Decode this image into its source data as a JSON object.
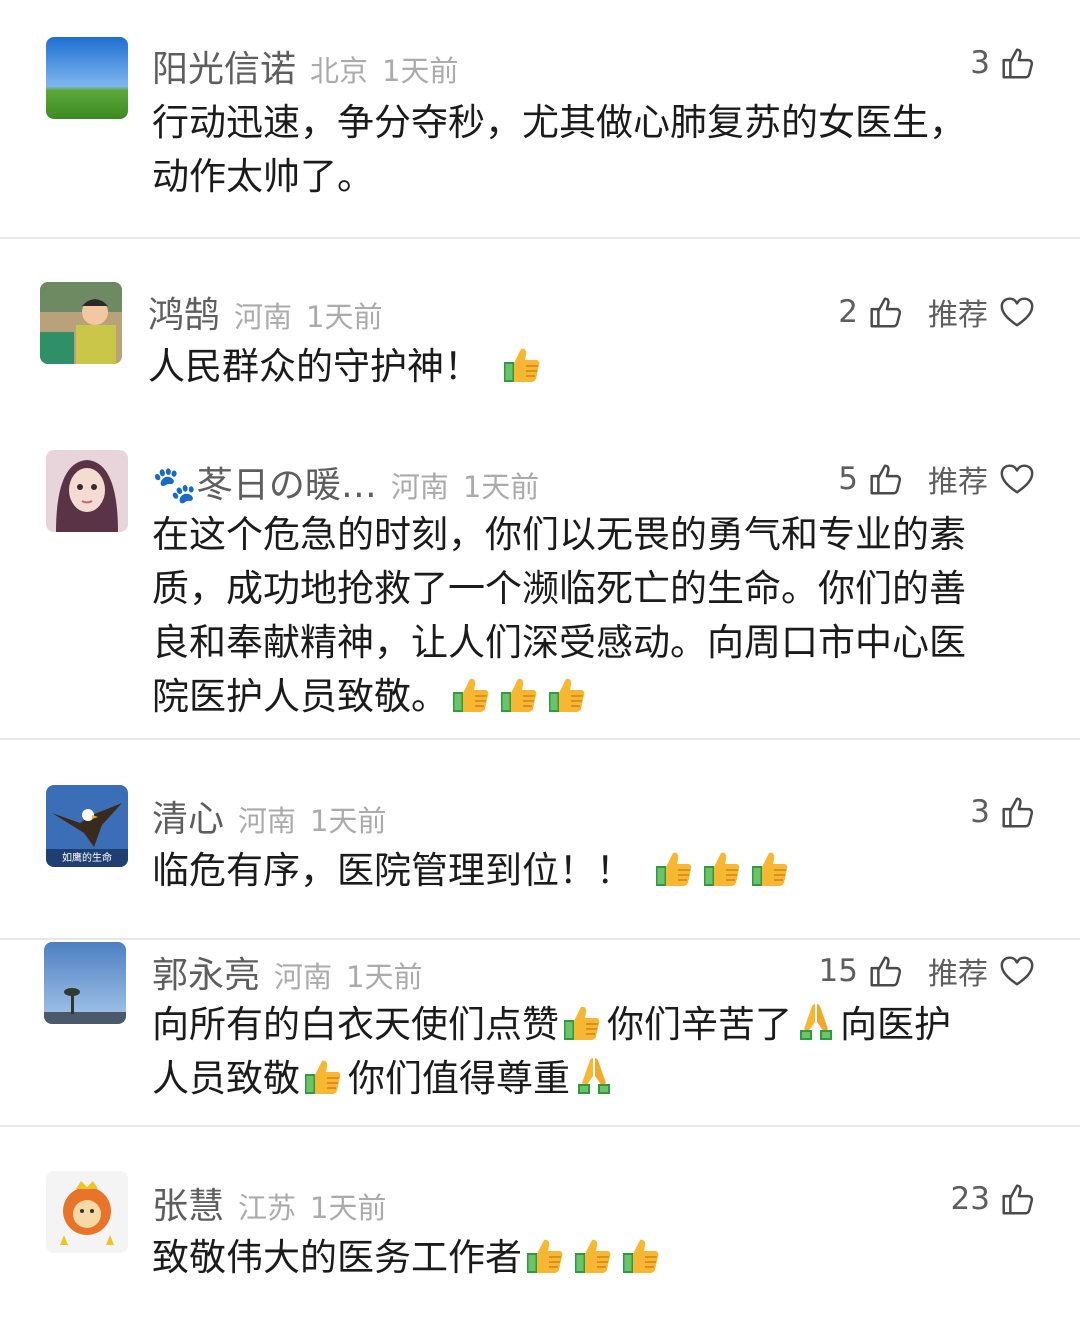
{
  "comments": [
    {
      "username": "阳光信诺",
      "location": "北京",
      "time": "1天前",
      "likes": "3",
      "recommend_label": "",
      "text": [
        "行动迅速，争分夺秒，尤其做心肺复苏的女医生，",
        "动作太帅了。"
      ]
    },
    {
      "username": "鸿鹄",
      "location": "河南",
      "time": "1天前",
      "likes": "2",
      "recommend_label": "推荐",
      "text_parts": [
        "人民群众的守护神！"
      ]
    },
    {
      "username": "🐾苳日の暖…",
      "location": "河南",
      "time": "1天前",
      "likes": "5",
      "recommend_label": "推荐",
      "text": [
        "在这个危急的时刻，你们以无畏的勇气和专业的素",
        "质，成功地抢救了一个濒临死亡的生命。你们的善",
        "良和奉献精神，让人们深受感动。向周口市中心医",
        "院医护人员致敬。"
      ]
    },
    {
      "username": "清心",
      "location": "河南",
      "time": "1天前",
      "likes": "3",
      "recommend_label": "",
      "text_parts": [
        "临危有序，医院管理到位！！"
      ],
      "avatar_caption": "如鹰的生命"
    },
    {
      "username": "郭永亮",
      "location": "河南",
      "time": "1天前",
      "likes": "15",
      "recommend_label": "推荐",
      "text_parts": [
        "向所有的白衣天使们点赞",
        "你们辛苦了",
        "向医护",
        "人员致敬",
        "你们值得尊重"
      ]
    },
    {
      "username": "张慧",
      "location": "江苏",
      "time": "1天前",
      "likes": "23",
      "recommend_label": "",
      "text_parts": [
        "致敬伟大的医务工作者"
      ]
    }
  ],
  "icons": {
    "like": "thumbs-up-outline-icon",
    "recommend": "heart-outline-icon",
    "emoji_thumbs": "thumbs-up-emoji-icon",
    "emoji_pray": "folded-hands-emoji-icon"
  },
  "colors": {
    "username": "#5e5e5e",
    "meta": "#ababab",
    "text": "#1b1b1b",
    "divider": "#e8e8e8"
  }
}
